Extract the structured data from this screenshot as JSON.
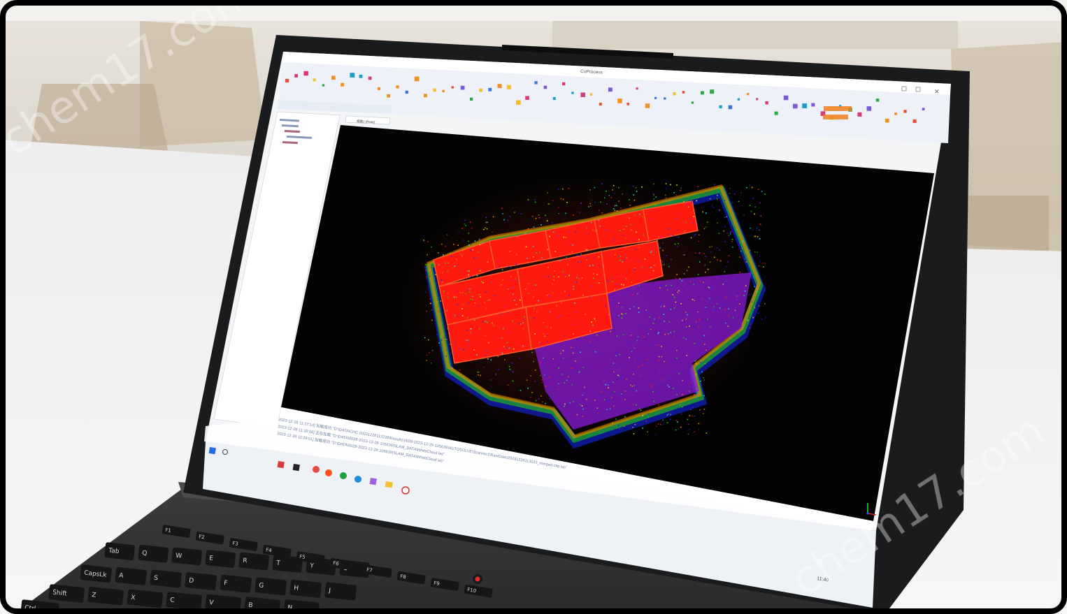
{
  "window": {
    "title": "CoProcess"
  },
  "viewport": {
    "tab_label": "视图1 (Point)"
  },
  "log_lines": [
    "2023-12-28 11:37:14] 加载成功 \"D:\\DATA\\CHC 20231228113228\\Results\\0028-2023-12-28-105639\\AUTOSOLVE\\Scanner1\\RawData\\20231228113533_merged-clip.las\"",
    "2023-12-28 11:38:06] 正在加载 \"D:\\DATA\\0028-2023-12-28-105639\\SLAM_DATA\\WhiteCloud.las\"",
    "2023-12-28 11:39:01] 加载成功 \"D:\\DATA\\0028-2023-12-28-105639\\SLAM_DATA\\WhiteCloud.las\""
  ],
  "keyboard": [
    "Tab",
    "Q",
    "W",
    "E",
    "R",
    "T",
    "Y",
    "U",
    "CapsLk",
    "A",
    "S",
    "D",
    "F",
    "G",
    "H",
    "J",
    "Shift",
    "Z",
    "X",
    "C",
    "V",
    "B",
    "N",
    "Ctrl",
    "F1",
    "F2",
    "F3",
    "F4",
    "F5",
    "F6",
    "F7",
    "F8",
    "F9",
    "F10"
  ],
  "watermark": "chem17.com",
  "colors": {
    "cloud_red": "#ff1a10",
    "cloud_orange": "#ff8a00",
    "cloud_green": "#22e000",
    "cloud_blue": "#1428ff",
    "cloud_purple": "#8a1ad8",
    "ribbon_orange": "#f08020"
  }
}
